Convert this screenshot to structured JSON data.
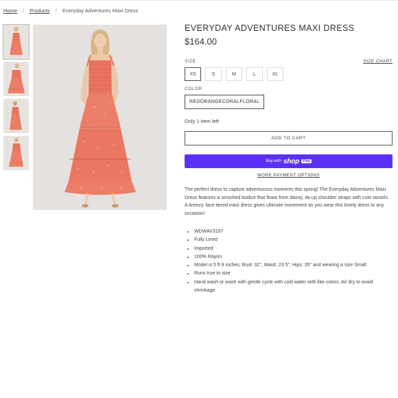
{
  "breadcrumb": {
    "home": "Home",
    "sep1": "/",
    "products": "Products",
    "sep2": "/",
    "current": "Everyday Adventures Maxi Dress"
  },
  "product": {
    "title": "EVERYDAY ADVENTURES MAXI DRESS",
    "price": "$164.00",
    "size_label": "SIZE",
    "size_chart": "SIZE CHART",
    "sizes": [
      "XS",
      "S",
      "M",
      "L",
      "XL"
    ],
    "selected_size": "XS",
    "color_label": "COLOR",
    "color_value": "REDORANGECORALFLORAL",
    "stock": "Only 1 item left",
    "add_to_cart": "ADD TO CART",
    "shop_pay": {
      "with": "Buy with",
      "shop": "shop",
      "pay": "Pay"
    },
    "more_payment": "MORE PAYMENT OPTIONS",
    "description": "The perfect dress to capture adventurous moments this spring! The Everyday Adventures Maxi Dress features a smocked bodice that flows from dainty, tie-up shoulder straps with cute tassels. A breezy, lace tiered maxi dress gives ultimate movement as you wear this lovely dress to any occasion!",
    "details": [
      "WDWAV3197",
      "Fully Lined",
      "Imported",
      "100% Rayon",
      "Model is 5 ft 9 inches; Bust: 32\", Waist: 23.5\", Hips: 35\" and wearing a size Small",
      "Runs true to size",
      "Hand wash or wash with gentle cycle with cold water with like colors. Air dry to avoid shrinkage."
    ]
  },
  "colors": {
    "dress": "#e8735f",
    "accent": "#5a31f4",
    "background": "#e5e1de"
  }
}
